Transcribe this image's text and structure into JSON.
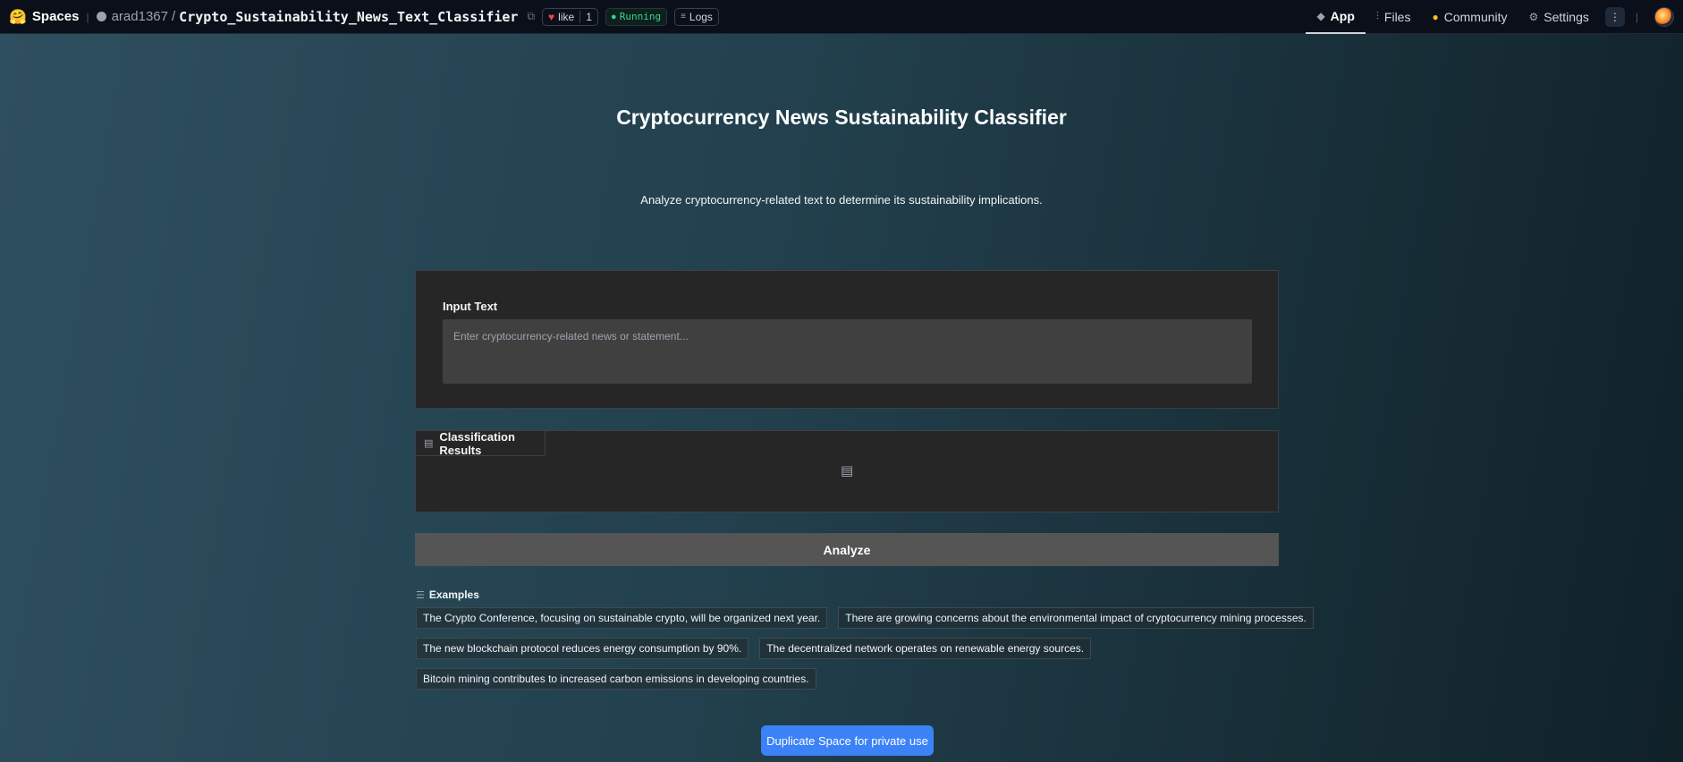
{
  "topbar": {
    "brand": "Spaces",
    "owner": "arad1367",
    "repo": "Crypto_Sustainability_News_Text_Classifier",
    "like_label": "like",
    "like_count": "1",
    "status": "Running",
    "logs_label": "Logs",
    "nav": [
      {
        "label": "App",
        "icon": "app-icon",
        "active": true
      },
      {
        "label": "Files",
        "icon": "files-icon",
        "active": false
      },
      {
        "label": "Community",
        "icon": "community-icon",
        "active": false
      },
      {
        "label": "Settings",
        "icon": "gear-icon",
        "active": false
      }
    ]
  },
  "app": {
    "title": "Cryptocurrency News Sustainability Classifier",
    "description": "Analyze cryptocurrency-related text to determine its sustainability implications.",
    "input": {
      "label": "Input Text",
      "placeholder": "Enter cryptocurrency-related news or statement..."
    },
    "results": {
      "label": "Classification Results"
    },
    "analyze_label": "Analyze",
    "examples_label": "Examples",
    "examples": [
      "The Crypto Conference, focusing on sustainable crypto, will be organized next year.",
      "There are growing concerns about the environmental impact of cryptocurrency mining processes.",
      "The new blockchain protocol reduces energy consumption by 90%.",
      "The decentralized network operates on renewable energy sources.",
      "Bitcoin mining contributes to increased carbon emissions in developing countries."
    ],
    "duplicate_label": "Duplicate Space for private use"
  },
  "colors": {
    "accent": "#3b82f6",
    "running": "#34d399",
    "heart": "#ef4444"
  }
}
